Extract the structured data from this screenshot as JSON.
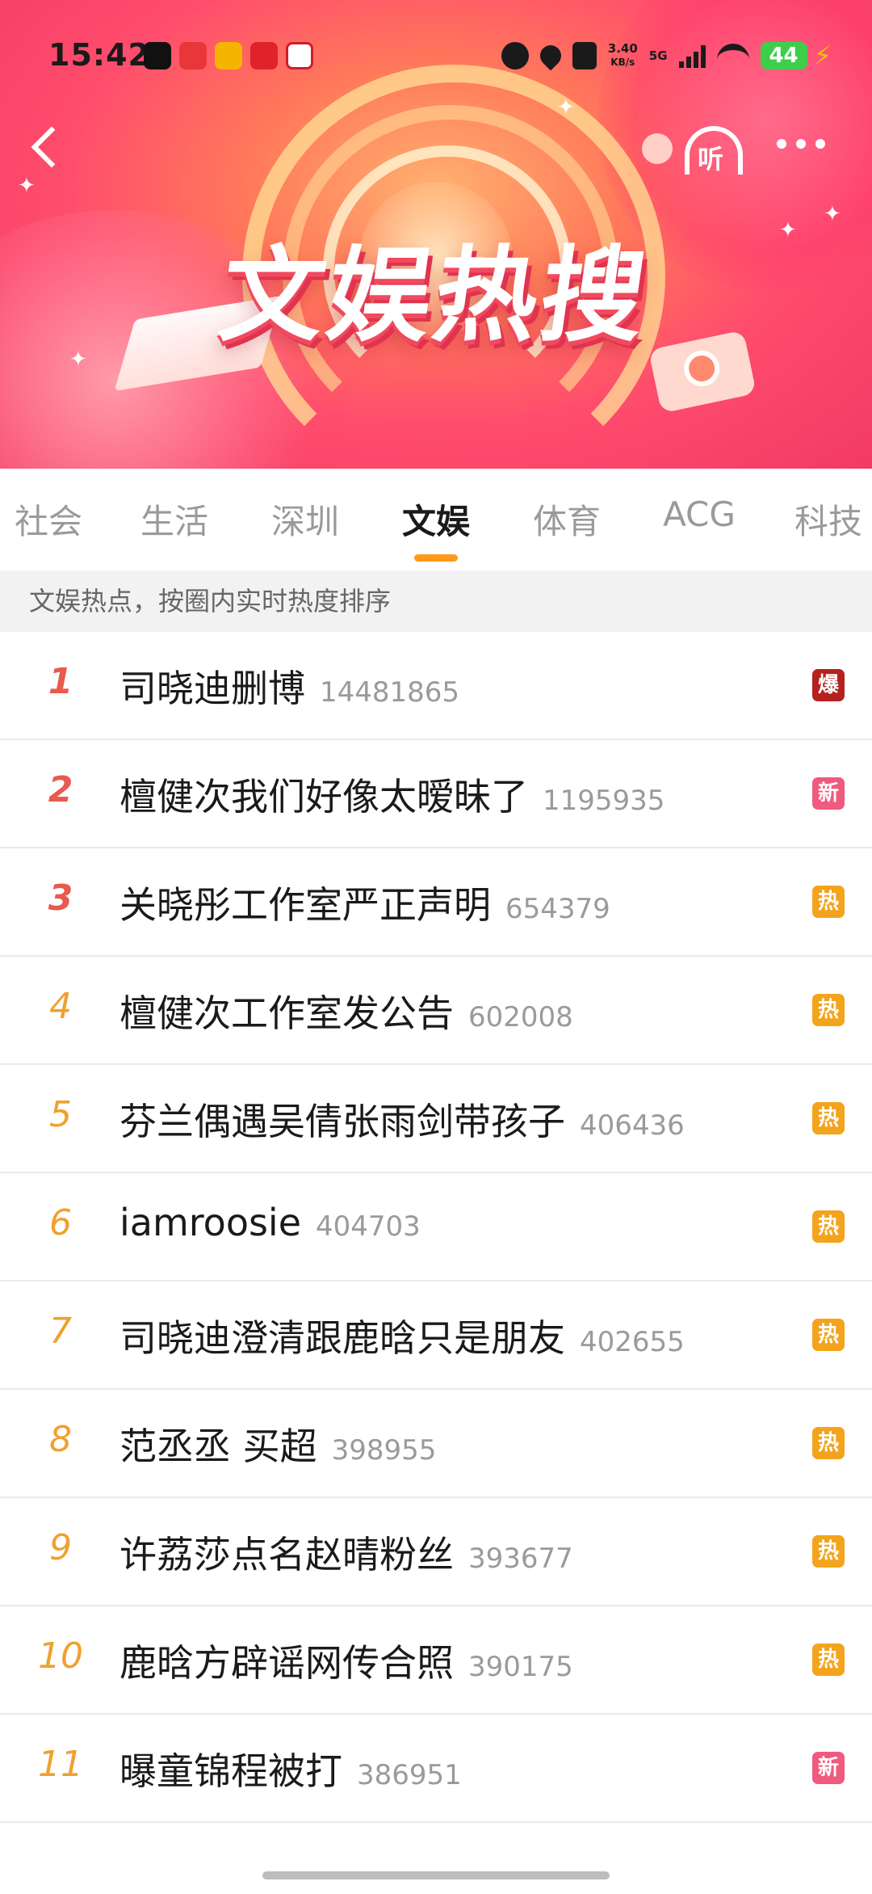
{
  "status_bar": {
    "time": "15:42",
    "net_speed_value": "3.40",
    "net_speed_unit": "KB/s",
    "network": "5G",
    "battery": "44"
  },
  "header": {
    "title": "文娱热搜",
    "listen_label": "听"
  },
  "tabs": [
    {
      "label": "社会"
    },
    {
      "label": "生活"
    },
    {
      "label": "深圳"
    },
    {
      "label": "文娱",
      "active": true
    },
    {
      "label": "体育"
    },
    {
      "label": "ACG"
    },
    {
      "label": "科技"
    }
  ],
  "subheading": "文娱热点，按圈内实时热度排序",
  "colors": {
    "badge_bao": "#b5211e",
    "badge_xin": "#f05a7e",
    "badge_re": "#f3a41c",
    "tab_indicator": "#ff9a1a"
  },
  "items": [
    {
      "rank": "1",
      "title": "司晓迪删博",
      "count": "14481865",
      "badge": "爆"
    },
    {
      "rank": "2",
      "title": "檀健次我们好像太暧昧了",
      "count": "1195935",
      "badge": "新"
    },
    {
      "rank": "3",
      "title": "关晓彤工作室严正声明",
      "count": "654379",
      "badge": "热"
    },
    {
      "rank": "4",
      "title": "檀健次工作室发公告",
      "count": "602008",
      "badge": "热"
    },
    {
      "rank": "5",
      "title": "芬兰偶遇吴倩张雨剑带孩子",
      "count": "406436",
      "badge": "热"
    },
    {
      "rank": "6",
      "title": "iamroosie",
      "count": "404703",
      "badge": "热"
    },
    {
      "rank": "7",
      "title": "司晓迪澄清跟鹿晗只是朋友",
      "count": "402655",
      "badge": "热"
    },
    {
      "rank": "8",
      "title": "范丞丞 买超",
      "count": "398955",
      "badge": "热"
    },
    {
      "rank": "9",
      "title": "许荔莎点名赵晴粉丝",
      "count": "393677",
      "badge": "热"
    },
    {
      "rank": "10",
      "title": "鹿晗方辟谣网传合照",
      "count": "390175",
      "badge": "热"
    },
    {
      "rank": "11",
      "title": "曝童锦程被打",
      "count": "386951",
      "badge": "新"
    }
  ]
}
